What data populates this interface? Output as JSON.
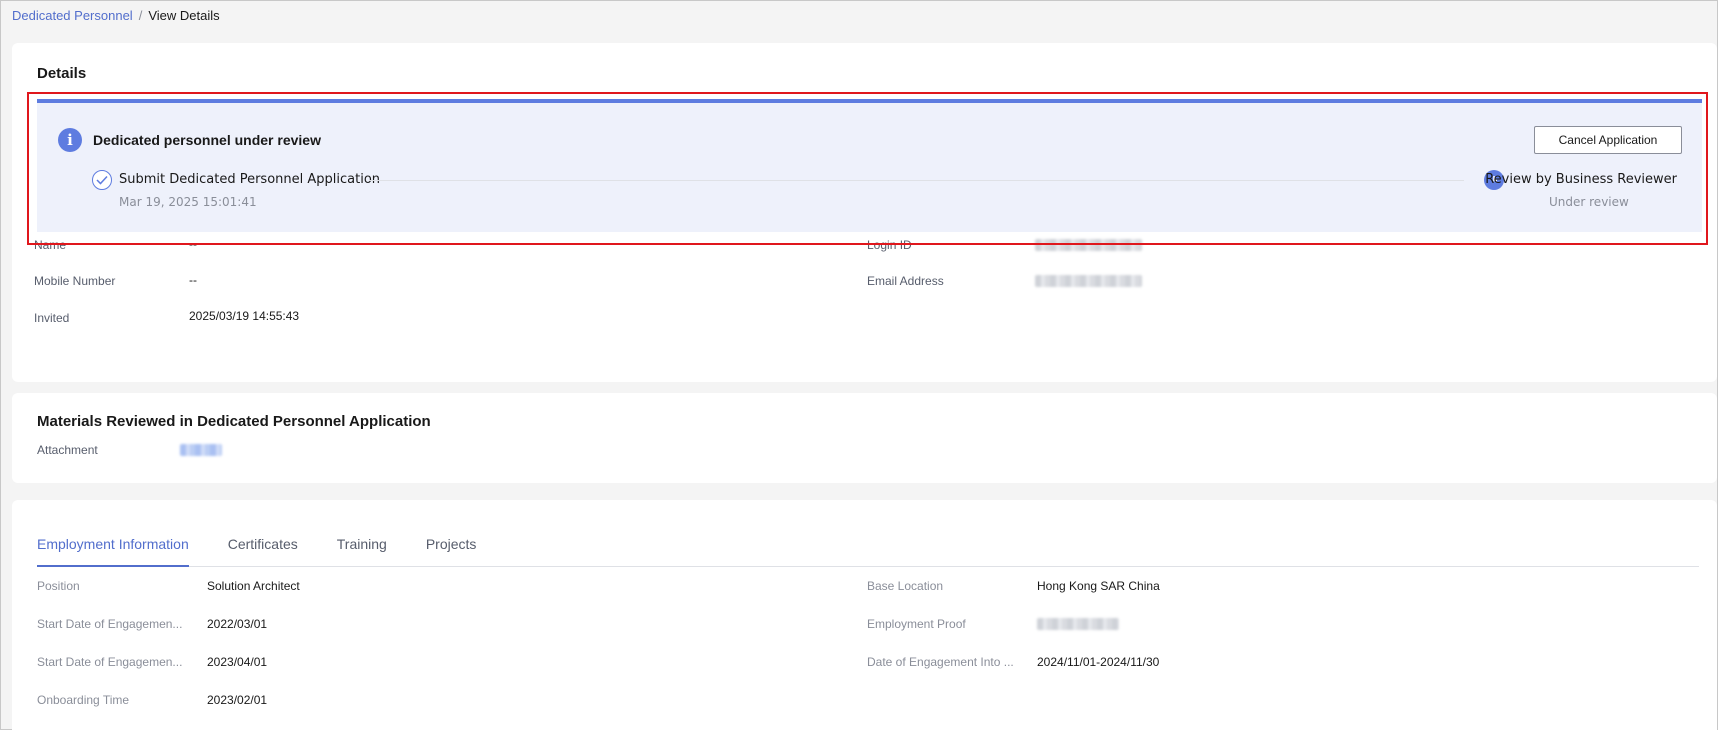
{
  "breadcrumb": {
    "parent": "Dedicated Personnel",
    "separator": "/",
    "current": "View Details"
  },
  "details": {
    "title": "Details",
    "notice": {
      "title": "Dedicated personnel under review",
      "cancel_label": "Cancel Application",
      "steps": [
        {
          "label": "Submit Dedicated Personnel Application",
          "sub": "Mar 19, 2025 15:01:41",
          "status": "done"
        },
        {
          "label": "Review by Business Reviewer",
          "sub": "Under review",
          "status": "in-progress"
        }
      ]
    },
    "fields": {
      "name_label": "Name",
      "name_value": "--",
      "mobile_label": "Mobile Number",
      "mobile_value": "--",
      "invited_label": "Invited",
      "invited_value": "2025/03/19 14:55:43",
      "login_label": "Login ID",
      "email_label": "Email Address"
    }
  },
  "materials": {
    "title": "Materials Reviewed in Dedicated Personnel Application",
    "attachment_label": "Attachment"
  },
  "employment": {
    "tabs": [
      "Employment Information",
      "Certificates",
      "Training",
      "Projects"
    ],
    "active_tab": 0,
    "left_fields": [
      {
        "label": "Position",
        "value": "Solution Architect"
      },
      {
        "label": "Start Date of Engagemen...",
        "value": "2022/03/01"
      },
      {
        "label": "Start Date of Engagemen...",
        "value": "2023/04/01"
      },
      {
        "label": "Onboarding Time",
        "value": "2023/02/01"
      }
    ],
    "right_fields": [
      {
        "label": "Base Location",
        "value": "Hong Kong SAR China"
      },
      {
        "label": "Employment Proof",
        "value": ""
      },
      {
        "label": "Date of Engagement Into ...",
        "value": "2024/11/01-2024/11/30"
      }
    ]
  },
  "colors": {
    "accent": "#5e7ce0",
    "link": "#526ecc",
    "highlight_frame": "#e0171d",
    "notice_bg": "#eef1fb"
  }
}
